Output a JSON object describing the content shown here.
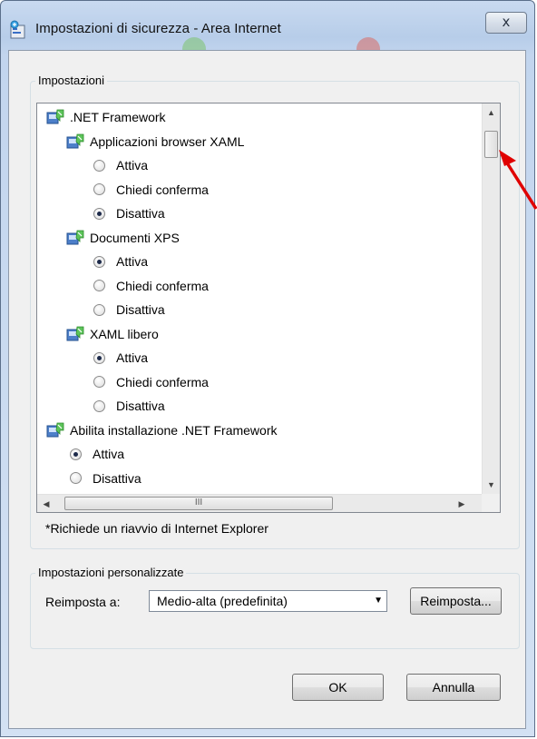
{
  "window": {
    "title": "Impostazioni di sicurezza - Area Internet",
    "close_glyph": "ⅹ"
  },
  "settings_group": {
    "label": "Impostazioni",
    "tree": [
      {
        "type": "node",
        "label": ".NET Framework",
        "indent": 0
      },
      {
        "type": "node",
        "label": "Applicazioni browser XAML",
        "indent": 1
      },
      {
        "type": "radio",
        "label": "Attiva",
        "indent": 2,
        "checked": false
      },
      {
        "type": "radio",
        "label": "Chiedi conferma",
        "indent": 2,
        "checked": false
      },
      {
        "type": "radio",
        "label": "Disattiva",
        "indent": 2,
        "checked": true
      },
      {
        "type": "node",
        "label": "Documenti XPS",
        "indent": 1
      },
      {
        "type": "radio",
        "label": "Attiva",
        "indent": 2,
        "checked": true
      },
      {
        "type": "radio",
        "label": "Chiedi conferma",
        "indent": 2,
        "checked": false
      },
      {
        "type": "radio",
        "label": "Disattiva",
        "indent": 2,
        "checked": false
      },
      {
        "type": "node",
        "label": "XAML libero",
        "indent": 1
      },
      {
        "type": "radio",
        "label": "Attiva",
        "indent": 2,
        "checked": true
      },
      {
        "type": "radio",
        "label": "Chiedi conferma",
        "indent": 2,
        "checked": false
      },
      {
        "type": "radio",
        "label": "Disattiva",
        "indent": 2,
        "checked": false
      },
      {
        "type": "node",
        "label": "Abilita installazione .NET Framework",
        "indent": 0
      },
      {
        "type": "radio",
        "label": "Attiva",
        "indent": 1,
        "checked": true
      },
      {
        "type": "radio",
        "label": "Disattiva",
        "indent": 1,
        "checked": false
      }
    ],
    "hscroll_grip": "III",
    "note": "*Richiede un riavvio di Internet Explorer"
  },
  "custom_group": {
    "label": "Impostazioni personalizzate",
    "reset_label": "Reimposta a:",
    "reset_value": "Medio-alta (predefinita)",
    "reset_button": "Reimposta..."
  },
  "footer": {
    "ok": "OK",
    "cancel": "Annulla"
  },
  "colors": {
    "annotation_arrow": "#e00000",
    "radio_dot": "#1d2a4a",
    "window_frame": "#c2d5ee"
  }
}
